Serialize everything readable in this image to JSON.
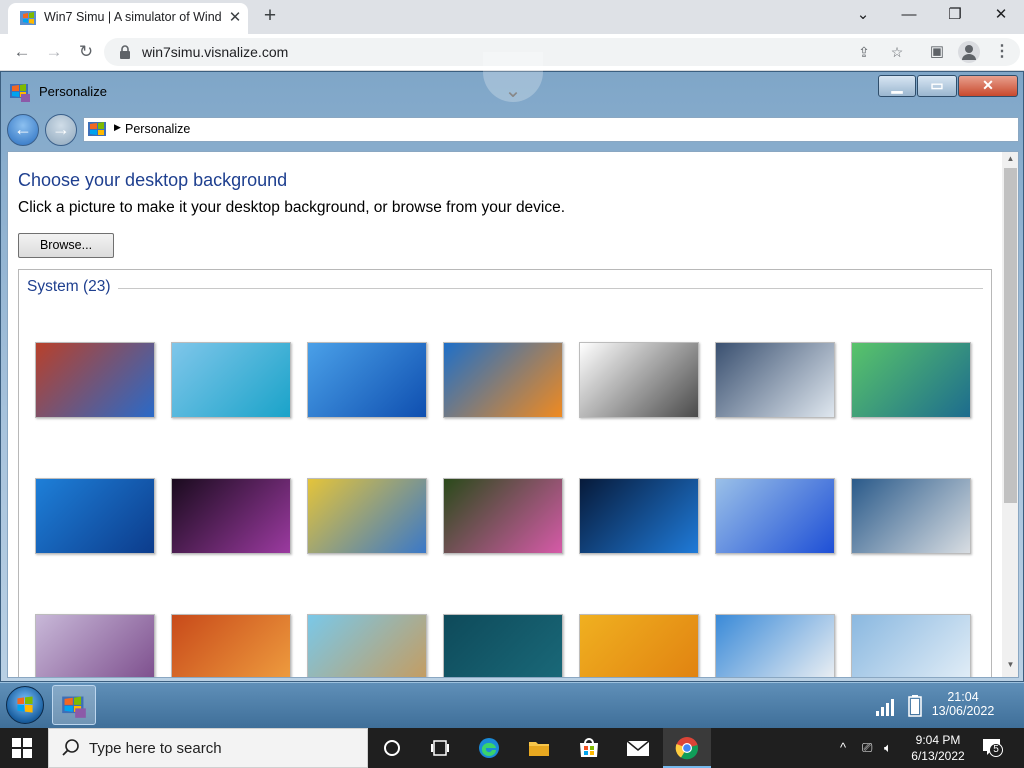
{
  "browser": {
    "tab_title": "Win7 Simu | A simulator of Windows 7",
    "new_tab_label": "+",
    "url": "win7simu.visnalize.com"
  },
  "window": {
    "title": "Personalize",
    "breadcrumb": "Personalize"
  },
  "personalize": {
    "heading": "Choose your desktop background",
    "subtitle": "Click a picture to make it your desktop background, or browse from your device.",
    "browse_label": "Browse...",
    "group_title": "System (23)",
    "wallpapers": [
      {
        "name": "space-needle",
        "colors": [
          "#b8402a",
          "#2a6ac8"
        ]
      },
      {
        "name": "tropical-sea",
        "colors": [
          "#7fc6ea",
          "#1aa3c9"
        ]
      },
      {
        "name": "windows-7-default",
        "colors": [
          "#4aa0e8",
          "#0f4fb0"
        ]
      },
      {
        "name": "orange-fish",
        "colors": [
          "#1e6fc8",
          "#f08a20"
        ]
      },
      {
        "name": "suitcase",
        "colors": [
          "#ffffff",
          "#4a4a4a"
        ]
      },
      {
        "name": "frozen-lake",
        "colors": [
          "#3a5070",
          "#dfe7ef"
        ]
      },
      {
        "name": "green-aurora",
        "colors": [
          "#59c46a",
          "#1d6c8e"
        ]
      },
      {
        "name": "blue-sky-light",
        "colors": [
          "#1e7fd8",
          "#0c3c8c"
        ]
      },
      {
        "name": "purple-dahlia",
        "colors": [
          "#1a0b1e",
          "#9b3aa0"
        ]
      },
      {
        "name": "yellow-tulips",
        "colors": [
          "#e4c43a",
          "#3a78c8"
        ]
      },
      {
        "name": "water-lilies",
        "colors": [
          "#2a4a1a",
          "#d65aa8"
        ]
      },
      {
        "name": "windows-10",
        "colors": [
          "#071a3a",
          "#1f7ad8"
        ]
      },
      {
        "name": "windows-11-bloom",
        "colors": [
          "#9ac0e8",
          "#1e4fd6"
        ]
      },
      {
        "name": "metal-spheres",
        "colors": [
          "#2a5a8a",
          "#d8dde2"
        ]
      },
      {
        "name": "lavender-field",
        "colors": [
          "#c8b8d8",
          "#7a4a8a"
        ]
      },
      {
        "name": "red-canyon",
        "colors": [
          "#c84a1a",
          "#f0a040"
        ]
      },
      {
        "name": "floating-city",
        "colors": [
          "#7ac8e8",
          "#c89a5a"
        ]
      },
      {
        "name": "dark-teal",
        "colors": [
          "#0e4a5a",
          "#1a6a7a"
        ]
      },
      {
        "name": "windows-8-yellow",
        "colors": [
          "#f0b020",
          "#e08010"
        ]
      },
      {
        "name": "daisies",
        "colors": [
          "#3a8ad8",
          "#f4f4f4"
        ]
      },
      {
        "name": "clouds",
        "colors": [
          "#8ab8e0",
          "#e6f0f8"
        ]
      }
    ]
  },
  "taskbar7": {
    "time": "21:04",
    "date": "13/06/2022"
  },
  "taskbar10": {
    "search_placeholder": "Type here to search",
    "time": "9:04 PM",
    "date": "6/13/2022",
    "notification_count": "5"
  }
}
